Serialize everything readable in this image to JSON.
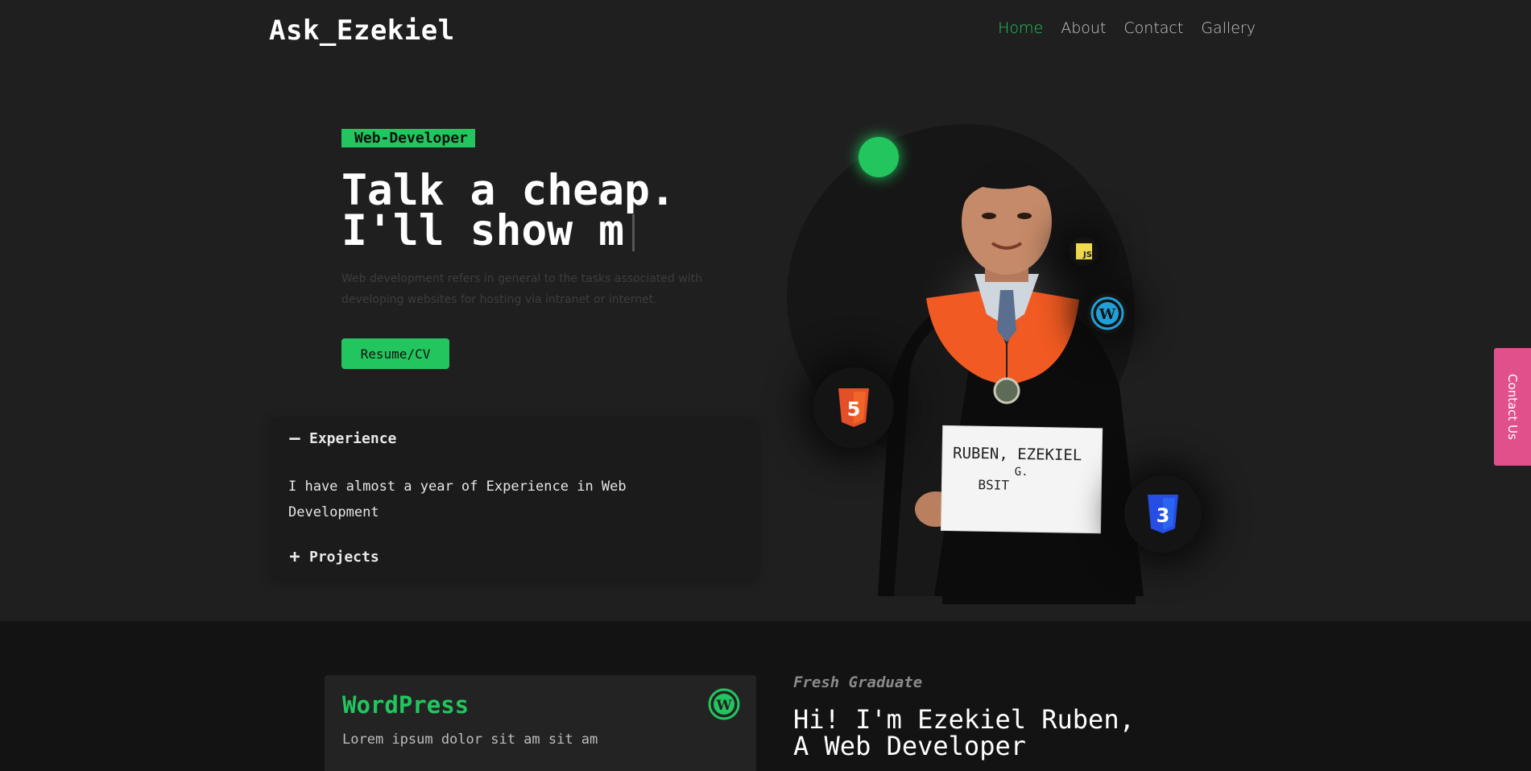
{
  "nav": {
    "brand": "Ask_Ezekiel",
    "links": [
      "Home",
      "About",
      "Contact",
      "Gallery"
    ],
    "active": "Home"
  },
  "hero": {
    "badge": "Web-Developer",
    "headline_line1": "Talk a cheap.",
    "headline_line2": "I'll show m",
    "description": "Web development refers in general to the tasks associated with developing websites for hosting via intranet or internet.",
    "cta": "Resume/CV"
  },
  "accordion": {
    "items": [
      {
        "title": "Experience",
        "expanded": true,
        "body": "I have almost a year of Experience in Web Development"
      },
      {
        "title": "Projects",
        "expanded": false
      }
    ]
  },
  "portrait": {
    "sign_line1": "RUBEN, EZEKIEL",
    "sign_line2": "G.",
    "sign_line3": "BSIT"
  },
  "tech_icons": [
    "js-icon",
    "wordpress-icon",
    "html5-icon",
    "css3-icon"
  ],
  "contact_tab": "Contact Us",
  "skills_card": {
    "title": "WordPress",
    "text": "Lorem ipsum dolor sit am sit am"
  },
  "about": {
    "tagline": "Fresh Graduate",
    "intro_line1": "Hi! I'm Ezekiel Ruben,",
    "intro_line2": "A Web Developer"
  },
  "colors": {
    "accent": "#22c55e",
    "background": "#1f1f1f",
    "contact_tab": "#e0508a"
  }
}
